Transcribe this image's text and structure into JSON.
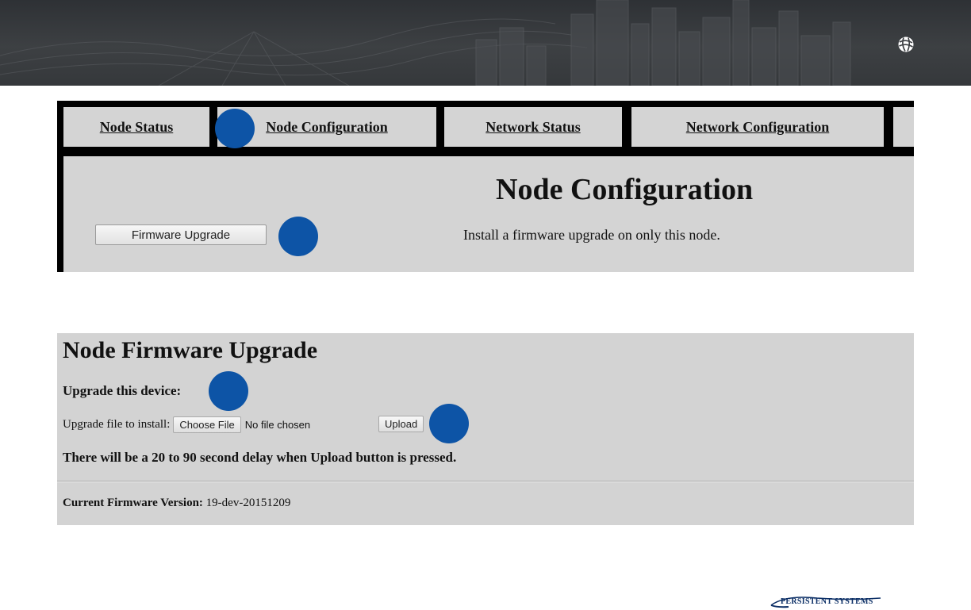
{
  "colors": {
    "banner_bg": "#3a3d40",
    "panel_gray": "#d4d4d4",
    "marker_blue": "#0d54a6",
    "brand_navy": "#0c2f66"
  },
  "banner": {
    "logo_icon": "persistent-systems-globe-icon"
  },
  "node_nav": {
    "tabs": [
      {
        "label": "Node Status"
      },
      {
        "label": "Node Configuration"
      },
      {
        "label": "Network Status"
      },
      {
        "label": "Network Configuration"
      }
    ],
    "heading": "Node Configuration",
    "firmware_button_label": "Firmware Upgrade",
    "firmware_description": "Install a firmware upgrade on only this node."
  },
  "firmware_page": {
    "title": "Node Firmware Upgrade",
    "subtitle": "Upgrade this device:",
    "file_label": "Upgrade file to install:",
    "choose_button_label": "Choose File",
    "no_file_text": "No file chosen",
    "upload_button_label": "Upload",
    "delay_note": "There will be a 20 to 90 second delay when Upload button is pressed.",
    "version_label": "Current Firmware Version:",
    "version_value": "19-dev-20151209"
  },
  "footer": {
    "brand_name": "PERSISTENT SYSTEMS"
  }
}
